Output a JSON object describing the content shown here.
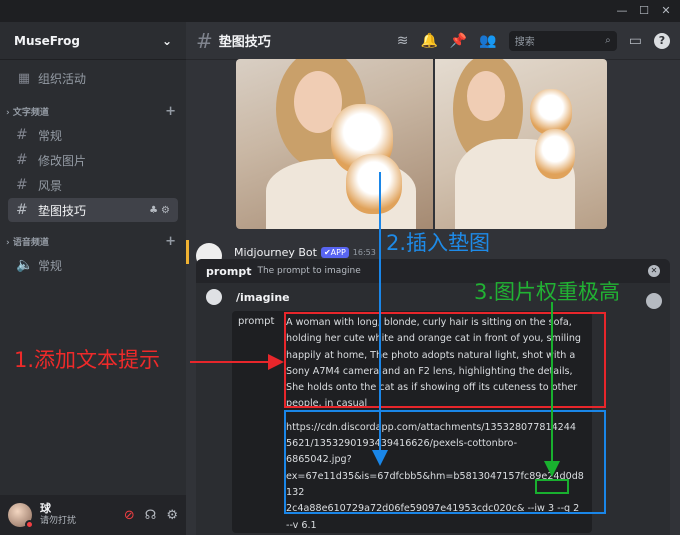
{
  "window": {
    "controls": [
      "—",
      "☐",
      "✕"
    ]
  },
  "server": {
    "name": "MuseFrog"
  },
  "sidebar": {
    "events_label": "组织活动",
    "text_category": "文字频道",
    "text_channels": [
      "常规",
      "修改图片",
      "风景",
      "垫图技巧"
    ],
    "active_channel_index": 3,
    "voice_category": "语音频道",
    "voice_channels": [
      "常规"
    ]
  },
  "user": {
    "name": "球",
    "status": "请勿打扰"
  },
  "channel": {
    "title": "垫图技巧"
  },
  "search": {
    "placeholder": "搜索"
  },
  "message": {
    "author": "Midjourney Bot",
    "badge": "✔APP",
    "time": "16:53"
  },
  "popup": {
    "option_key": "prompt",
    "option_desc": "The prompt to imagine",
    "command": "/imagine",
    "field_label": "prompt",
    "prompt_text": "A woman with long, blonde, curly hair is sitting on the sofa, holding her cute white and orange cat in front of you, smiling happily at home, The photo adopts natural light, shot with a Sony A7M4 camera and an F2 lens, highlighting the details, She holds onto the cat as if showing off its cuteness to other people, in casual",
    "url_lines": [
      "https://cdn.discordapp.com/attachments/135328077814244",
      "5621/1353290193439416626/pexels-cottonbro-",
      "6865042.jpg?",
      "ex=67e11d35&is=67dfcbb5&hm=b5813047157fc89e24d0d8132",
      "2c4a88e610729a72d06fe59097e41953cdc020c&"
    ],
    "iw_param": "--iw 3",
    "tail_params": " --q 2",
    "last_line": "--v 6.1"
  },
  "annotations": {
    "step1": "1.添加文本提示",
    "step2": "2.插入垫图",
    "step3": "3.图片权重极高",
    "colors": {
      "red": "#e8262b",
      "blue": "#1a86e8",
      "green": "#19b02f"
    }
  }
}
